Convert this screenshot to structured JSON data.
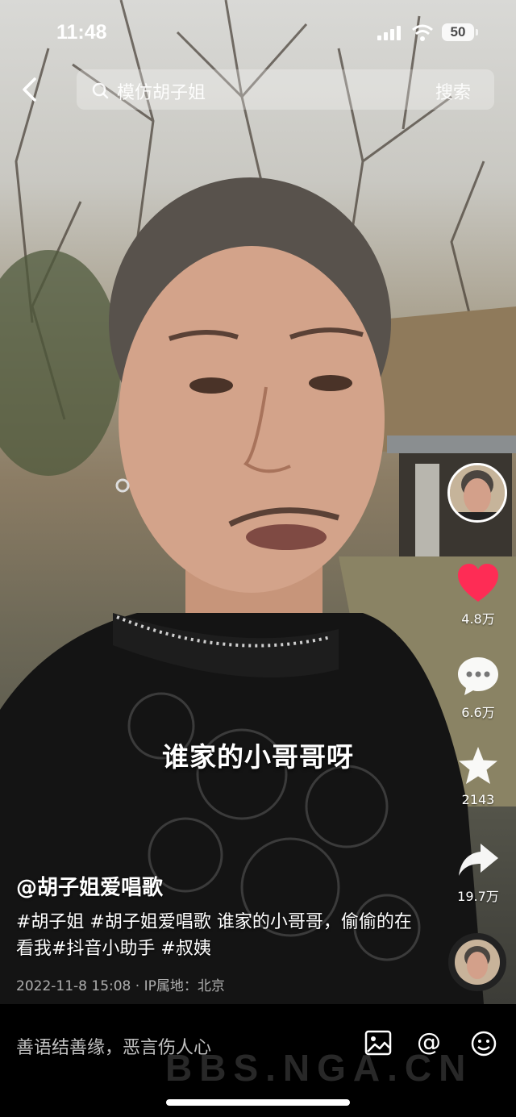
{
  "status_bar": {
    "time": "11:48",
    "battery": "50"
  },
  "search": {
    "query": "模仿胡子姐",
    "button_label": "搜索"
  },
  "actions": {
    "likes": "4.8万",
    "comments": "6.6万",
    "favorites": "2143",
    "shares": "19.7万"
  },
  "video": {
    "subtitle": "谁家的小哥哥呀",
    "author": "@胡子姐爱唱歌",
    "description": "#胡子姐 #胡子姐爱唱歌  谁家的小哥哥，偷偷的在看我#抖音小助手 #叔姨",
    "meta": "2022-11-8 15:08 · IP属地：北京"
  },
  "bottom_bar": {
    "comment_placeholder": "善语结善缘，恶言伤人心",
    "watermark": "BBS.NGA.CN"
  },
  "colors": {
    "like_active": "#fe2c55",
    "background": "#000000"
  },
  "icons": [
    "back-arrow-icon",
    "search-icon",
    "heart-icon",
    "comment-icon",
    "star-icon",
    "share-icon",
    "image-icon",
    "at-icon",
    "emoji-icon"
  ]
}
